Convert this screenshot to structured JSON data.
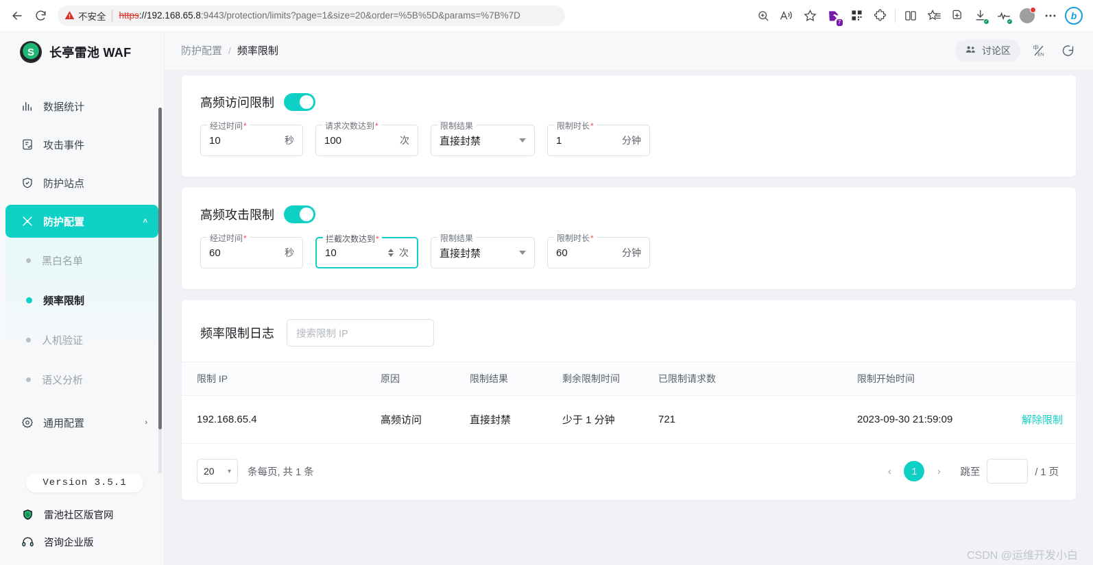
{
  "browser": {
    "security_label": "不安全",
    "url_protocol": "https",
    "url_host": "://192.168.65.8",
    "url_rest": ":9443/protection/limits?page=1&size=20&order=%5B%5D&params=%7B%7D",
    "back_icon": "back-arrow-icon",
    "reload_icon": "reload-icon",
    "zoom_icon": "zoom-in-icon",
    "read_aloud_icon": "read-aloud-icon",
    "favorite_icon": "star-icon",
    "collections_badge": "7",
    "extensions_icon": "puzzle-icon",
    "split_icon": "split-screen-icon",
    "favorites_bar_icon": "favorites-icon",
    "add_tab_icon": "add-collection-icon",
    "downloads_icon": "downloads-icon",
    "performance_icon": "performance-icon",
    "settings_icon": "ellipsis-icon",
    "copilot_icon": "b"
  },
  "sidebar": {
    "brand": {
      "logo_letter": "S",
      "name": "长亭雷池 WAF"
    },
    "items": [
      {
        "label": "数据统计",
        "icon": "bar-chart-icon",
        "active": false
      },
      {
        "label": "攻击事件",
        "icon": "document-check-icon",
        "active": false
      },
      {
        "label": "防护站点",
        "icon": "shield-icon",
        "active": false
      },
      {
        "label": "防护配置",
        "icon": "tools-icon",
        "active": true,
        "chevron": "˄"
      }
    ],
    "submenu": [
      {
        "label": "黑白名单",
        "active": false
      },
      {
        "label": "频率限制",
        "active": true
      },
      {
        "label": "人机验证",
        "active": false
      },
      {
        "label": "语义分析",
        "active": false
      }
    ],
    "general_config": {
      "label": "通用配置",
      "icon": "gear-icon",
      "chevron": "›"
    },
    "version": "Version 3.5.1",
    "footer_links": [
      {
        "label": "雷池社区版官网",
        "icon": "shield-badge-icon"
      },
      {
        "label": "咨询企业版",
        "icon": "headset-icon"
      }
    ]
  },
  "topbar": {
    "breadcrumb_parent": "防护配置",
    "breadcrumb_sep": "/",
    "breadcrumb_current": "频率限制",
    "discussion_button": "讨论区",
    "discussion_icon": "people-icon",
    "language_icon": "language-toggle-icon",
    "logout_icon": "logout-icon"
  },
  "cards": [
    {
      "title": "高频访问限制",
      "enabled": true,
      "fields": [
        {
          "label": "经过时间",
          "required": true,
          "value": "10",
          "suffix": "秒",
          "type": "text",
          "focused": false
        },
        {
          "label": "请求次数达到",
          "required": true,
          "value": "100",
          "suffix": "次",
          "type": "text",
          "focused": false
        },
        {
          "label": "限制结果",
          "required": false,
          "value": "直接封禁",
          "suffix": "",
          "type": "select",
          "focused": false
        },
        {
          "label": "限制时长",
          "required": true,
          "value": "1",
          "suffix": "分钟",
          "type": "text",
          "focused": false
        }
      ]
    },
    {
      "title": "高频攻击限制",
      "enabled": true,
      "fields": [
        {
          "label": "经过时间",
          "required": true,
          "value": "60",
          "suffix": "秒",
          "type": "text",
          "focused": false
        },
        {
          "label": "拦截次数达到",
          "required": true,
          "value": "10",
          "suffix": "次",
          "type": "number",
          "focused": true
        },
        {
          "label": "限制结果",
          "required": false,
          "value": "直接封禁",
          "suffix": "",
          "type": "select",
          "focused": false
        },
        {
          "label": "限制时长",
          "required": true,
          "value": "60",
          "suffix": "分钟",
          "type": "text",
          "focused": false
        }
      ]
    }
  ],
  "log": {
    "title": "频率限制日志",
    "search_placeholder": "搜索限制 IP",
    "search_value": "",
    "columns": [
      "限制 IP",
      "原因",
      "限制结果",
      "剩余限制时间",
      "已限制请求数",
      "限制开始时间",
      ""
    ],
    "rows": [
      {
        "ip": "192.168.65.4",
        "reason": "高频访问",
        "result": "直接封禁",
        "remaining": "少于 1 分钟",
        "count": "721",
        "start_time": "2023-09-30 21:59:09",
        "action": "解除限制"
      }
    ],
    "pagination": {
      "page_size": "20",
      "page_size_caret": "▾",
      "info": "条每页, 共 1 条",
      "prev": "‹",
      "current_page": "1",
      "next": "›",
      "jump_label": "跳至",
      "jump_value": "",
      "total_pages": "/ 1 页"
    }
  },
  "watermark": "CSDN @运维开发小白",
  "colors": {
    "accent": "#0fd0c5",
    "sidebar_bg": "#f7f8fa",
    "page_bg": "#f0f2f5",
    "required_star": "#f04a4a"
  }
}
